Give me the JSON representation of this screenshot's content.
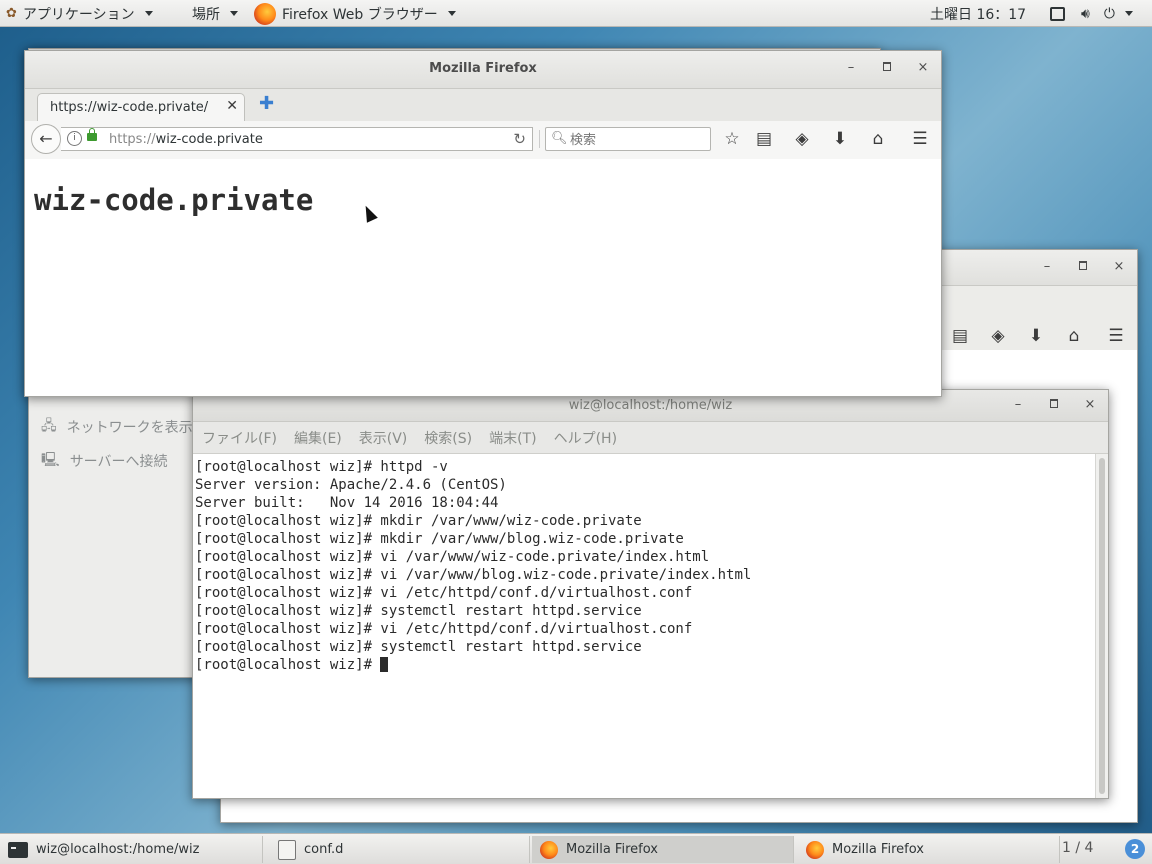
{
  "top_panel": {
    "apps_label": "アプリケーション",
    "places_label": "場所",
    "active_app": "Firefox Web ブラウザー",
    "clock": "土曜日 16：17"
  },
  "back_window": {
    "buttons": [
      "–",
      "×"
    ]
  },
  "file_manager": {
    "sidebar_items": [
      "ネットワークを表示",
      "サーバーへ接続"
    ]
  },
  "terminal": {
    "title": "wiz@localhost:/home/wiz",
    "menu": [
      "ファイル(F)",
      "編集(E)",
      "表示(V)",
      "検索(S)",
      "端末(T)",
      "ヘルプ(H)"
    ],
    "lines": [
      "[root@localhost wiz]# httpd -v",
      "Server version: Apache/2.4.6 (CentOS)",
      "Server built:   Nov 14 2016 18:04:44",
      "[root@localhost wiz]# mkdir /var/www/wiz-code.private",
      "[root@localhost wiz]# mkdir /var/www/blog.wiz-code.private",
      "[root@localhost wiz]# vi /var/www/wiz-code.private/index.html",
      "[root@localhost wiz]# vi /var/www/blog.wiz-code.private/index.html",
      "[root@localhost wiz]# vi /etc/httpd/conf.d/virtualhost.conf",
      "[root@localhost wiz]# systemctl restart httpd.service",
      "[root@localhost wiz]# vi /etc/httpd/conf.d/virtualhost.conf",
      "[root@localhost wiz]# systemctl restart httpd.service"
    ],
    "prompt": "[root@localhost wiz]# "
  },
  "firefox": {
    "title": "Mozilla Firefox",
    "tab_label": "https://wiz-code.private/",
    "url_scheme": "https://",
    "url_host": "wiz-code.private",
    "search_placeholder": "検索",
    "page_heading": "wiz-code.private"
  },
  "taskbar": {
    "tasks": [
      "wiz@localhost:/home/wiz",
      "conf.d",
      "Mozilla Firefox",
      "Mozilla Firefox"
    ],
    "workspace": "1 / 4",
    "help": "2"
  }
}
